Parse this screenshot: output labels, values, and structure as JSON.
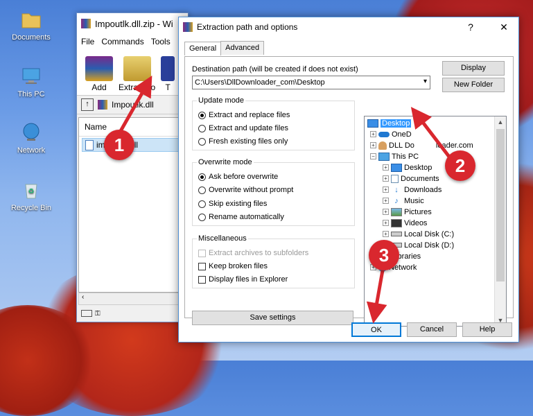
{
  "desktop": {
    "icons": [
      {
        "label": "Documents",
        "icon": "folder-icon"
      },
      {
        "label": "This PC",
        "icon": "computer-icon"
      },
      {
        "label": "Network",
        "icon": "network-icon"
      },
      {
        "label": "Recycle Bin",
        "icon": "recycle-bin-icon"
      }
    ]
  },
  "rar": {
    "title": "Impoutlk.dll.zip - Wi",
    "menu": [
      "File",
      "Commands",
      "Tools"
    ],
    "toolbar": {
      "add": "Add",
      "extract": "Extract To",
      "next": "T"
    },
    "path": "Impoutlk.dll",
    "column": "Name",
    "file": "impoutlk.dll"
  },
  "dialog": {
    "title": "Extraction path and options",
    "help": "?",
    "close": "✕",
    "tabs": [
      "General",
      "Advanced"
    ],
    "dest_label": "Destination path (will be created if does not exist)",
    "dest_value": "C:\\Users\\DllDownloader_com\\Desktop",
    "display_btn": "Display",
    "new_folder_btn": "New Folder",
    "update_mode": {
      "caption": "Update mode",
      "options": [
        "Extract and replace files",
        "Extract and update files",
        "Fresh existing files only"
      ],
      "selected": 0
    },
    "overwrite_mode": {
      "caption": "Overwrite mode",
      "options": [
        "Ask before overwrite",
        "Overwrite without prompt",
        "Skip existing files",
        "Rename automatically"
      ],
      "selected": 0
    },
    "misc": {
      "caption": "Miscellaneous",
      "options": [
        "Extract archives to subfolders",
        "Keep broken files",
        "Display files in Explorer"
      ]
    },
    "save_settings": "Save settings",
    "ok": "OK",
    "cancel": "Cancel",
    "help_btn": "Help",
    "tree": [
      {
        "label": "Desktop",
        "icon": "desktop-icon",
        "selected": true
      },
      {
        "label": "OneD",
        "icon": "onedrive-icon"
      },
      {
        "label": "DLL Do",
        "icon": "user-icon"
      },
      {
        "label": "This PC",
        "icon": "computer-icon"
      },
      {
        "label": "Desktop",
        "icon": "desktop-icon"
      },
      {
        "label": "Documents",
        "icon": "documents-icon"
      },
      {
        "label": "Downloads",
        "icon": "downloads-icon"
      },
      {
        "label": "Music",
        "icon": "music-icon"
      },
      {
        "label": "Pictures",
        "icon": "pictures-icon"
      },
      {
        "label": "Videos",
        "icon": "videos-icon"
      },
      {
        "label": "Local Disk (C:)",
        "icon": "drive-icon"
      },
      {
        "label": "Local Disk (D:)",
        "icon": "drive-icon"
      },
      {
        "label": "Libraries",
        "icon": "libraries-icon"
      },
      {
        "label": "Network",
        "icon": "network-icon"
      }
    ],
    "tree_overlap_text": "loader.com"
  },
  "annotations": {
    "step1": "1",
    "step2": "2",
    "step3": "3"
  },
  "colors": {
    "badge": "#d9272e",
    "selection": "#3399ff",
    "dialog_border": "#4e8fd4"
  }
}
